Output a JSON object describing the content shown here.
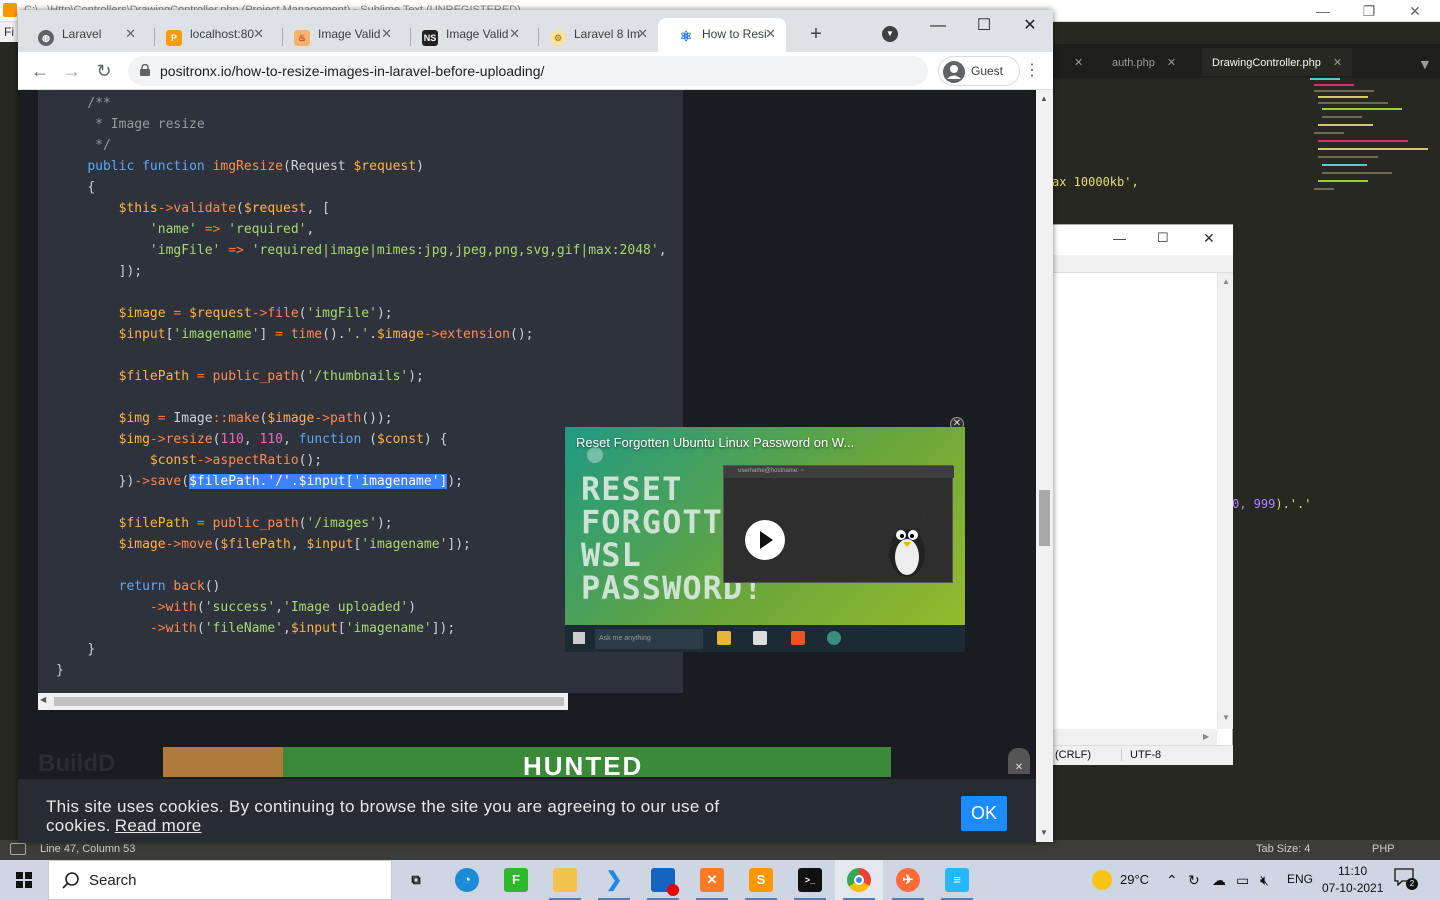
{
  "sublime": {
    "title": "C:\\...\\Http\\Controllers\\DrawingController.php (Project Management) - Sublime Text (UNREGISTERED)",
    "menu_label": "Fi",
    "tabs": [
      {
        "label": "auth.php"
      },
      {
        "label": "DrawingController.php"
      }
    ],
    "code_fragment_1": "ax 10000kb',",
    "code_fragment_2_num": "0, 999",
    "code_fragment_2_tail": ").'.'",
    "status": {
      "position": "Line 47, Column 53",
      "tab_size": "Tab Size: 4",
      "syntax": "PHP"
    }
  },
  "notepad": {
    "line_ending": "(CRLF)",
    "encoding": "UTF-8"
  },
  "chrome": {
    "tabs": [
      {
        "title": "Laravel",
        "icon": "globe-icon"
      },
      {
        "title": "localhost:80",
        "icon": "phpmyadmin-icon"
      },
      {
        "title": "Image Valid",
        "icon": "flame-icon"
      },
      {
        "title": "Image Valid",
        "icon": "ns-icon"
      },
      {
        "title": "Laravel 8 Im",
        "icon": "laravel-icon"
      },
      {
        "title": "How to Resi",
        "icon": "atom-icon",
        "active": true
      }
    ],
    "url": "positronx.io/how-to-resize-images-in-laravel-before-uploading/",
    "profile": "Guest"
  },
  "page": {
    "ad_left_text": "BuildD",
    "ad_headline": "HUNTED",
    "video": {
      "title": "Reset Forgotten Ubuntu Linux Password on W...",
      "big_text_lines": [
        "RESET",
        "FORGOTTEN",
        "WSL",
        "PASSWORD!"
      ],
      "taskbar_search": "Ask me anything",
      "terminal_title": "username@hostname: ~"
    },
    "cookie": {
      "text": "This site uses cookies. By continuing to browse the site you are agreeing to our use of cookies.",
      "link": "Read more",
      "ok": "OK"
    }
  },
  "taskbar": {
    "search_label": "Search",
    "weather_temp": "29°C",
    "language": "ENG",
    "time": "11:10",
    "date": "07-10-2021",
    "notification_count": "2"
  }
}
